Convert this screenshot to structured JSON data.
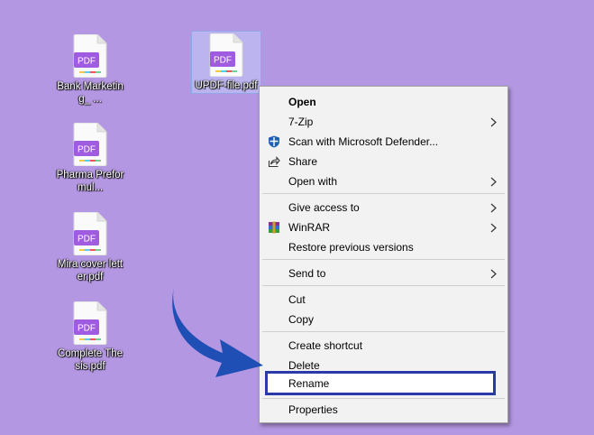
{
  "desktop": {
    "icons": [
      {
        "label": "Bank Marketing_ ...",
        "badge": "PDF"
      },
      {
        "label": "Pharma Preformul...",
        "badge": "PDF"
      },
      {
        "label": "Mira cover letter.pdf",
        "badge": "PDF"
      },
      {
        "label": "Complete Thesis.pdf",
        "badge": "PDF"
      },
      {
        "label": "UPDF-file.pdf",
        "badge": "PDF"
      }
    ]
  },
  "context_menu": {
    "items": [
      {
        "label": "Open"
      },
      {
        "label": "7-Zip"
      },
      {
        "label": "Scan with Microsoft Defender..."
      },
      {
        "label": "Share"
      },
      {
        "label": "Open with"
      },
      {
        "label": "Give access to"
      },
      {
        "label": "WinRAR"
      },
      {
        "label": "Restore previous versions"
      },
      {
        "label": "Send to"
      },
      {
        "label": "Cut"
      },
      {
        "label": "Copy"
      },
      {
        "label": "Create shortcut"
      },
      {
        "label": "Delete"
      },
      {
        "label": "Rename"
      },
      {
        "label": "Properties"
      }
    ]
  },
  "colors": {
    "desktop_bg": "#b497e2",
    "pdf_badge": "#a05ce0",
    "highlight_border": "#2a3aa8",
    "arrow": "#1f4fb4"
  }
}
